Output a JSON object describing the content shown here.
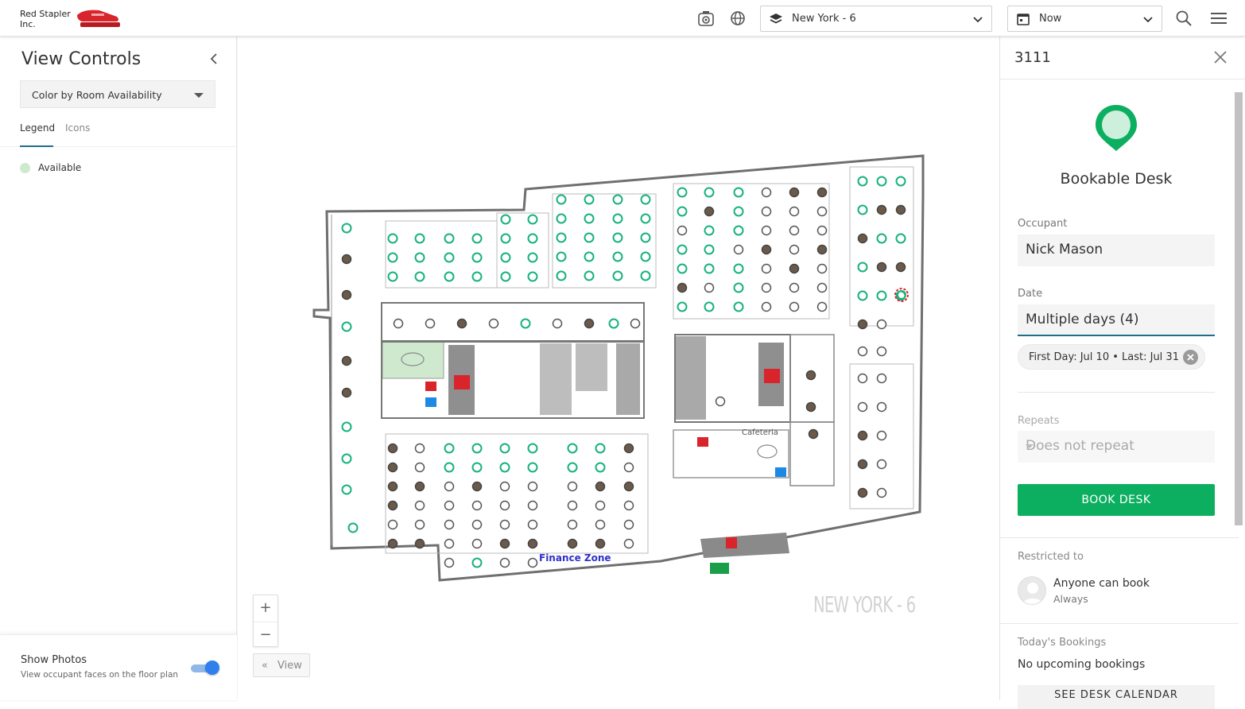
{
  "header": {
    "company": "Red Stapler Inc.",
    "building_select": "New York - 6",
    "time_select": "Now",
    "icons": [
      "webcam-icon",
      "globe-icon",
      "layers-icon",
      "calendar-icon",
      "search-icon",
      "menu-icon"
    ]
  },
  "left_panel": {
    "title": "View Controls",
    "color_by": "Color by Room Availability",
    "tabs": [
      "Legend",
      "Icons"
    ],
    "active_tab": "Legend",
    "legend": [
      {
        "label": "Available",
        "color": "#cfe9cf"
      }
    ],
    "show_photos": {
      "title": "Show Photos",
      "subtitle": "View occupant faces on the floor plan",
      "enabled": true
    }
  },
  "map": {
    "floor_label": "NEW YORK - 6",
    "zone_label": "Finance Zone",
    "cafeteria_label": "Cafeteria",
    "zoom_in": "+",
    "zoom_out": "−",
    "view_button": "View"
  },
  "right_panel": {
    "desk_id": "3111",
    "type_title": "Bookable Desk",
    "occupant_label": "Occupant",
    "occupant_value": "Nick Mason",
    "date_label": "Date",
    "date_value": "Multiple days (4)",
    "date_chip": "First Day: Jul 10 • Last: Jul 31",
    "repeats_label": "Repeats",
    "repeats_value": "Does not repeat",
    "book_button": "BOOK DESK",
    "restricted_label": "Restricted to",
    "restricted_value": "Anyone can book",
    "restricted_sub": "Always",
    "todays_bookings_label": "Today's Bookings",
    "todays_bookings_value": "No upcoming bookings",
    "calendar_button": "SEE DESK CALENDAR",
    "accent": "#0caf60"
  }
}
